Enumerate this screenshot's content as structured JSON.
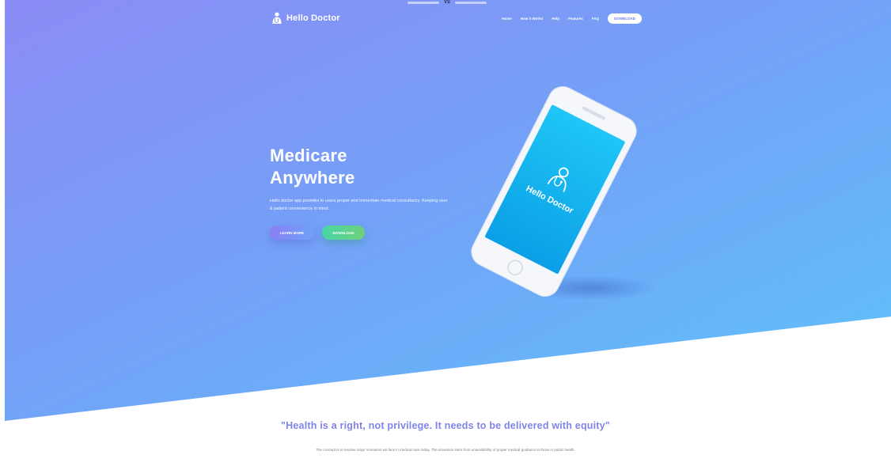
{
  "nav": {
    "brand": "Hello Doctor",
    "links": [
      "Home",
      "How it Works",
      "Help",
      "Features",
      "FAQ"
    ],
    "cta_label": "DOWNLOAD"
  },
  "hero": {
    "title_line1": "Medicare",
    "title_line2": "Anywhere",
    "subtitle": "Hello doctor app provides to users proper and immediate medical consultancy. Keeping user & patient convenience in mind.",
    "learn_more_label": "LEARN MORE",
    "download_label": "DOWNLOAD"
  },
  "phone": {
    "screen_text": "Hello Doctor"
  },
  "quote_section": {
    "quote": "\"Health is a right, not privilege. It needs to be delivered with equity\"",
    "description": "The concept is to resolve major scenarios we face in medical care today. The scenarios stem from unavailability of proper medical guidance to those in public health."
  },
  "colors": {
    "gradient_start": "#8b8cf5",
    "gradient_end": "#5dc4fb",
    "quote_color": "#7f84ea",
    "download_green": "#48d6a4"
  },
  "icons": {
    "logo": "doctor-icon",
    "phone_logo": "doctor-icon"
  }
}
